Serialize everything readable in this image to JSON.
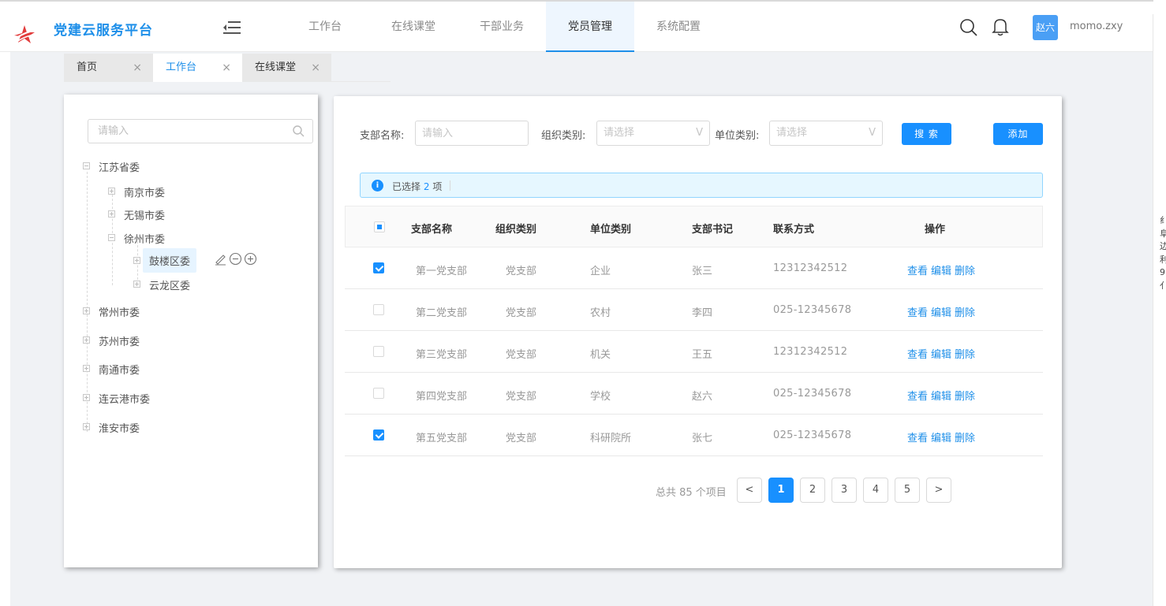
{
  "app": {
    "title": "党建云服务平台"
  },
  "nav": {
    "items": [
      "工作台",
      "在线课堂",
      "干部业务",
      "党员管理",
      "系统配置"
    ],
    "active_index": 3
  },
  "user": {
    "avatar_text": "赵六",
    "name": "momo.zxy"
  },
  "tabs": [
    {
      "label": "首页",
      "active": false
    },
    {
      "label": "工作台",
      "active": true
    },
    {
      "label": "在线课堂",
      "active": false
    }
  ],
  "tab_close_glyph": "×",
  "tree": {
    "search_placeholder": "请输入",
    "nodes": {
      "jiangsu": "江苏省委",
      "nanjing": "南京市委",
      "wuxi": "无锡市委",
      "xuzhou": "徐州市委",
      "gulou": "鼓楼区委",
      "yunlong": "云龙区委",
      "changzhou": "常州市委",
      "suzhou": "苏州市委",
      "nantong": "南通市委",
      "lianyungang": "连云港市委",
      "huaian": "淮安市委"
    },
    "selected": "gulou"
  },
  "filters": {
    "branch_label": "支部名称:",
    "branch_placeholder": "请输入",
    "org_label": "组织类别:",
    "org_placeholder": "请选择",
    "unit_label": "单位类别:",
    "unit_placeholder": "请选择",
    "select_arrow": "V",
    "search_button": "搜 索",
    "add_button": "添加"
  },
  "alert": {
    "prefix": "已选择",
    "count": "2",
    "suffix": "项",
    "icon": "i"
  },
  "table": {
    "columns": [
      "支部名称",
      "组织类别",
      "单位类别",
      "支部书记",
      "联系方式",
      "操作"
    ],
    "header_checkbox": "indeterminate",
    "rows": [
      {
        "checked": true,
        "name": "第一党支部",
        "org": "党支部",
        "unit": "企业",
        "secretary": "张三",
        "contact": "12312342512"
      },
      {
        "checked": false,
        "name": "第二党支部",
        "org": "党支部",
        "unit": "农村",
        "secretary": "李四",
        "contact": "025-12345678"
      },
      {
        "checked": false,
        "name": "第三党支部",
        "org": "党支部",
        "unit": "机关",
        "secretary": "王五",
        "contact": "12312342512"
      },
      {
        "checked": false,
        "name": "第四党支部",
        "org": "党支部",
        "unit": "学校",
        "secretary": "赵六",
        "contact": "025-12345678"
      },
      {
        "checked": true,
        "name": "第五党支部",
        "org": "党支部",
        "unit": "科研院所",
        "secretary": "张七",
        "contact": "025-12345678"
      }
    ],
    "actions": {
      "view": "查看",
      "edit": "编辑",
      "delete": "删除"
    }
  },
  "pagination": {
    "total_text": "总共 85 个项目",
    "pages": [
      "1",
      "2",
      "3",
      "4",
      "5"
    ],
    "current": "1",
    "prev": "<",
    "next": ">"
  },
  "edge_text": [
    "纟",
    "阜",
    "边",
    "利",
    "9",
    "亻"
  ],
  "colors": {
    "primary": "#1890ff",
    "brand": "#1e8fe9",
    "logo_red": "#e23c3c",
    "page_bg": "#f0f2f5"
  }
}
